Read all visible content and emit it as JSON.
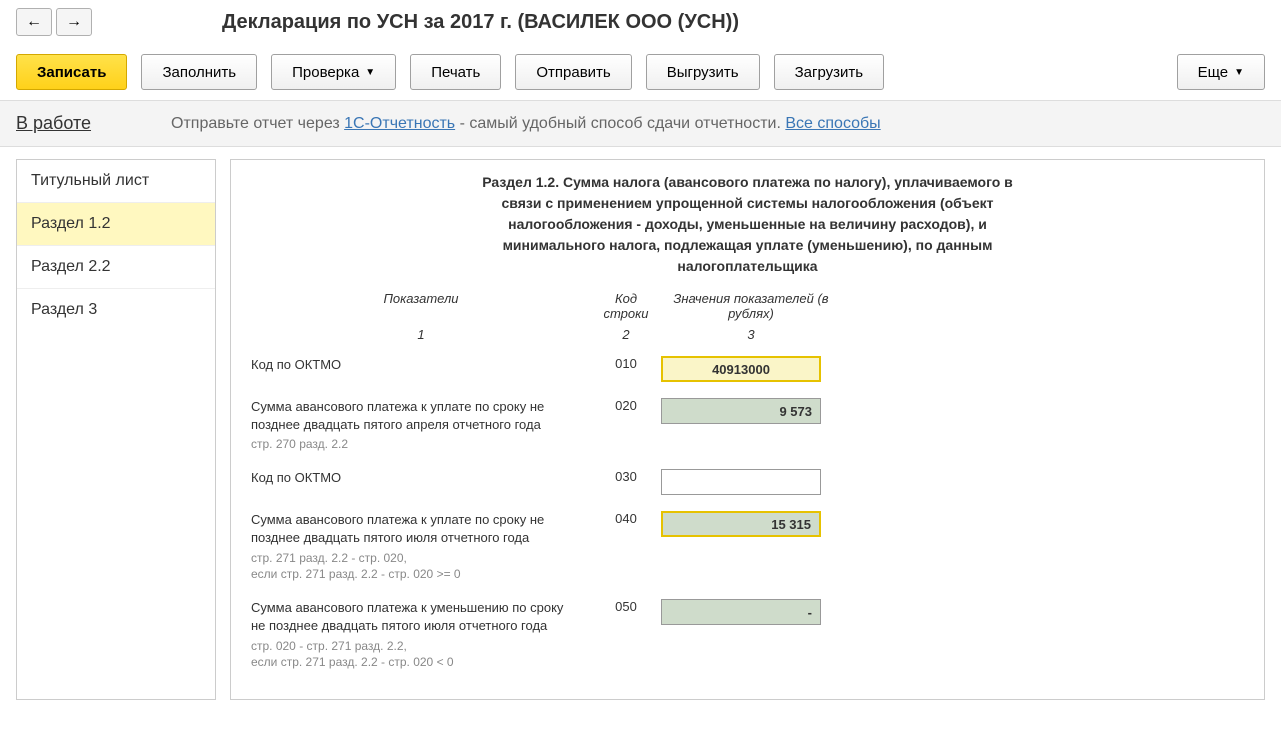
{
  "header": {
    "title": "Декларация по УСН за 2017 г. (ВАСИЛЕК ООО (УСН))"
  },
  "toolbar": {
    "save": "Записать",
    "fill": "Заполнить",
    "check": "Проверка",
    "print": "Печать",
    "send": "Отправить",
    "export": "Выгрузить",
    "import": "Загрузить",
    "more": "Еще"
  },
  "status": {
    "label": "В работе",
    "prefix": "Отправьте отчет через ",
    "link1": "1С-Отчетность",
    "middle": " - самый удобный способ сдачи отчетности. ",
    "link2": "Все способы"
  },
  "sidebar": {
    "items": [
      {
        "label": "Титульный лист"
      },
      {
        "label": "Раздел 1.2"
      },
      {
        "label": "Раздел 2.2"
      },
      {
        "label": "Раздел 3"
      }
    ]
  },
  "section": {
    "title": "Раздел 1.2. Сумма налога (авансового платежа по налогу), уплачиваемого в связи с применением упрощенной системы налогообложения (объект налогообложения - доходы, уменьшенные на величину расходов), и минимального налога, подлежащая уплате (уменьшению), по данным налогоплательщика",
    "col1": "Показатели",
    "col2": "Код строки",
    "col3": "Значения показателей (в рублях)",
    "n1": "1",
    "n2": "2",
    "n3": "3"
  },
  "rows": [
    {
      "label": "Код по ОКТМО",
      "sub": "",
      "code": "010",
      "value": "40913000",
      "style": "yellow-hl"
    },
    {
      "label": "Сумма авансового платежа к уплате по сроку не позднее двадцать пятого апреля отчетного года",
      "sub": "стр. 270 разд. 2.2",
      "code": "020",
      "value": "9 573",
      "style": "green"
    },
    {
      "label": "Код по ОКТМО",
      "sub": "",
      "code": "030",
      "value": "",
      "style": "white"
    },
    {
      "label": "Сумма  авансового платежа к уплате по сроку не позднее двадцать пятого июля отчетного года",
      "sub": "стр. 271 разд. 2.2 - стр. 020,\nесли стр. 271 разд. 2.2 - стр. 020 >= 0",
      "code": "040",
      "value": "15 315",
      "style": "green-hl"
    },
    {
      "label": "Сумма авансового платежа к уменьшению по сроку не позднее двадцать пятого июля отчетного года",
      "sub": "стр. 020 - стр. 271 разд. 2.2,\nесли стр. 271 разд. 2.2 - стр. 020 < 0",
      "code": "050",
      "value": "-",
      "style": "green"
    }
  ]
}
